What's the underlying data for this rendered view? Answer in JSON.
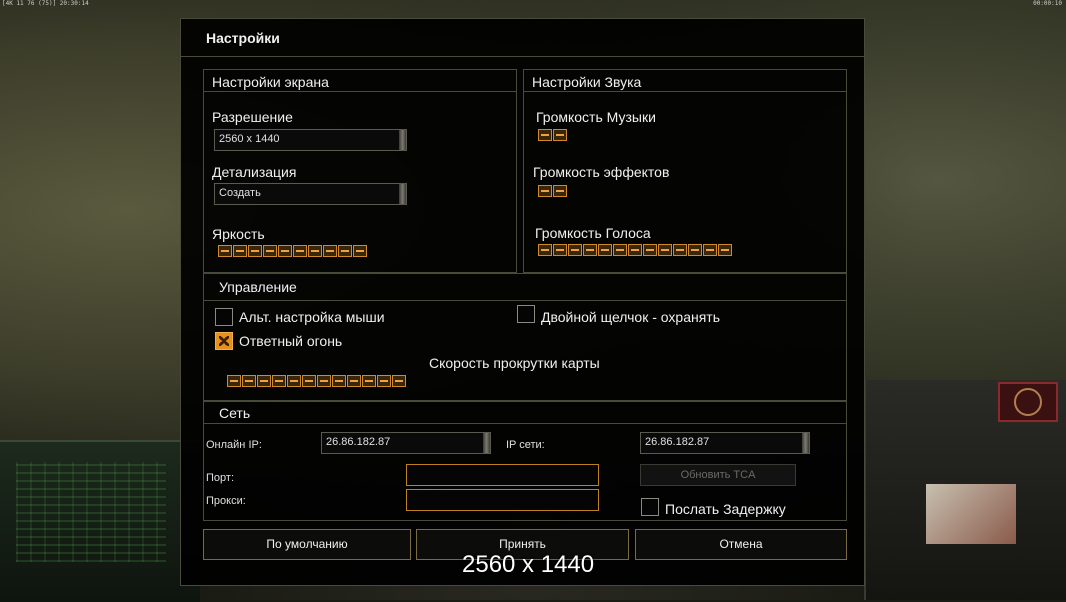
{
  "status_bar": {
    "left": "[4K 11 76 (75)] 20:30:14",
    "right": "00:00:10"
  },
  "dialog": {
    "title": "Настройки"
  },
  "screen": {
    "header": "Настройки экрана",
    "resolution_label": "Разрешение",
    "resolution_value": "2560 x 1440",
    "detail_label": "Детализация",
    "detail_value": "Создать",
    "brightness_label": "Яркость",
    "brightness_level": 10
  },
  "sound": {
    "header": "Настройки Звука",
    "music_label": "Громкость Музыки",
    "music_level": 2,
    "effects_label": "Громкость эффектов",
    "effects_level": 2,
    "voice_label": "Громкость Голоса",
    "voice_level": 13
  },
  "control": {
    "header": "Управление",
    "alt_mouse_label": "Альт. настройка мыши",
    "alt_mouse_checked": false,
    "double_click_label": "Двойной щелчок - охранять",
    "double_click_checked": false,
    "retaliation_label": "Ответный огонь",
    "retaliation_checked": true,
    "scroll_label": "Скорость прокрутки карты",
    "scroll_level": 12
  },
  "network": {
    "header": "Сеть",
    "online_ip_label": "Онлайн IP:",
    "online_ip_value": "26.86.182.87",
    "lan_ip_label": "IP сети:",
    "lan_ip_value": "26.86.182.87",
    "port_label": "Порт:",
    "port_value": "",
    "proxy_label": "Прокси:",
    "proxy_value": "",
    "update_button": "Обновить TCA",
    "send_delay_label": "Послать Задержку",
    "send_delay_checked": false
  },
  "buttons": {
    "default": "По умолчанию",
    "accept": "Принять",
    "cancel": "Отмена"
  },
  "caption": "2560 x 1440",
  "colors": {
    "accent": "#e6901a",
    "border": "#4a4a3a",
    "panel_bg": "#000000"
  }
}
